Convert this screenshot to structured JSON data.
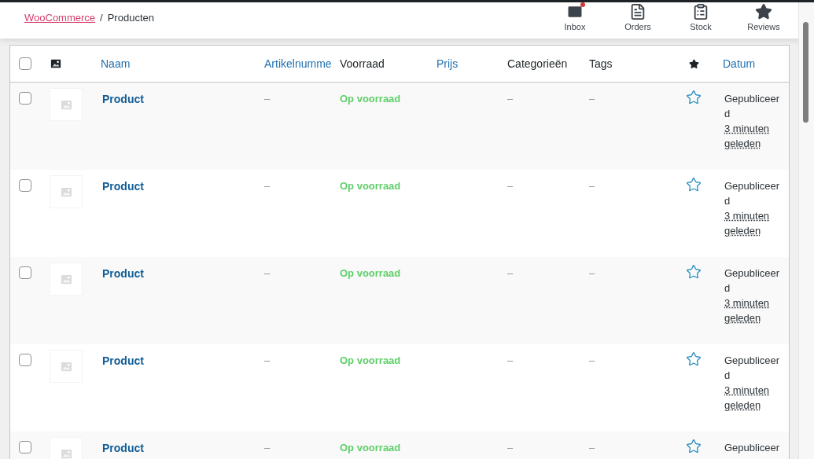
{
  "breadcrumb": {
    "link": "WooCommerce",
    "separator": "/",
    "current": "Producten"
  },
  "top_actions": [
    {
      "kind": "inbox",
      "label": "Inbox",
      "badge": true
    },
    {
      "kind": "orders",
      "label": "Orders",
      "badge": false
    },
    {
      "kind": "stock",
      "label": "Stock",
      "badge": false
    },
    {
      "kind": "reviews",
      "label": "Reviews",
      "badge": false
    }
  ],
  "table": {
    "select_all": {
      "checked": false
    },
    "columns": [
      {
        "kind": "thumb"
      },
      {
        "kind": "text",
        "label": "Naam",
        "sortable": true
      },
      {
        "kind": "text",
        "label": "Artikelnumme",
        "sortable": true
      },
      {
        "kind": "text",
        "label": "Voorraad",
        "sortable": false
      },
      {
        "kind": "text",
        "label": "Prijs",
        "sortable": true
      },
      {
        "kind": "text",
        "label": "Categorieën",
        "sortable": false
      },
      {
        "kind": "text",
        "label": "Tags",
        "sortable": false
      },
      {
        "kind": "featured"
      },
      {
        "kind": "text",
        "label": "Datum",
        "sortable": true
      }
    ],
    "rows": [
      {
        "checked": false,
        "name": "Product",
        "sku": "–",
        "stock": "Op voorraad",
        "price": "",
        "categories": "–",
        "tags": "–",
        "featured": false,
        "status": "Gepubliceerd",
        "date": "3 minuten geleden"
      },
      {
        "checked": false,
        "name": "Product",
        "sku": "–",
        "stock": "Op voorraad",
        "price": "",
        "categories": "–",
        "tags": "–",
        "featured": false,
        "status": "Gepubliceerd",
        "date": "3 minuten geleden"
      },
      {
        "checked": false,
        "name": "Product",
        "sku": "–",
        "stock": "Op voorraad",
        "price": "",
        "categories": "–",
        "tags": "–",
        "featured": false,
        "status": "Gepubliceerd",
        "date": "3 minuten geleden"
      },
      {
        "checked": false,
        "name": "Product",
        "sku": "–",
        "stock": "Op voorraad",
        "price": "",
        "categories": "–",
        "tags": "–",
        "featured": false,
        "status": "Gepubliceerd",
        "date": "3 minuten geleden"
      },
      {
        "checked": false,
        "name": "Product",
        "sku": "–",
        "stock": "Op voorraad",
        "price": "",
        "categories": "–",
        "tags": "–",
        "featured": false,
        "status": "Gepubliceer"
      }
    ]
  }
}
